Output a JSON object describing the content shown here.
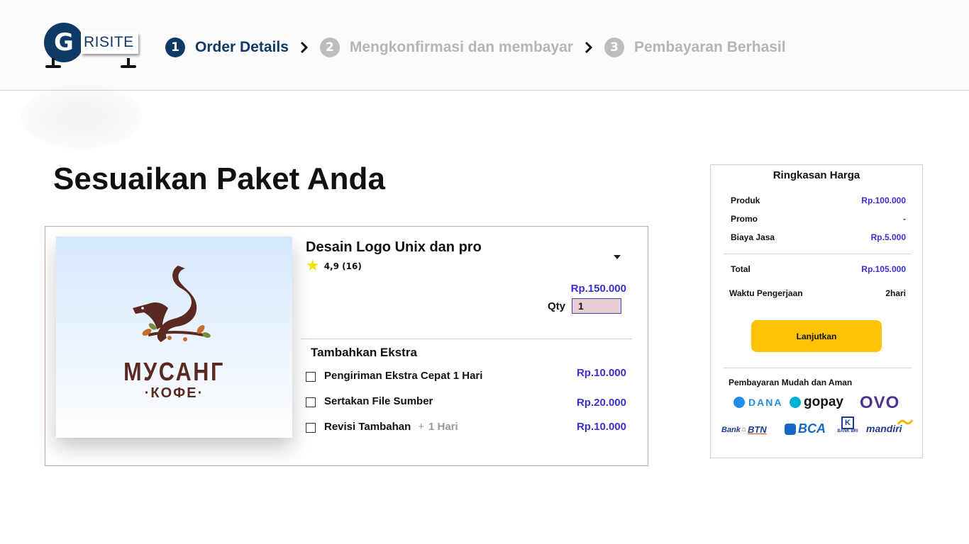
{
  "header": {
    "logo": {
      "letter": "G",
      "text": "RISITE"
    },
    "steps": [
      {
        "num": "1",
        "label": "Order Details"
      },
      {
        "num": "2",
        "label": "Mengkonfirmasi dan membayar"
      },
      {
        "num": "3",
        "label": "Pembayaran Berhasil"
      }
    ]
  },
  "page_title": "Sesuaikan Paket Anda",
  "product": {
    "brand": {
      "name": "МУСАНГ",
      "sub": "·КОФЕ·"
    },
    "name": "Desain Logo Unix dan pro",
    "rating": "4,9 (16)",
    "price": "Rp.150.000",
    "qty_label": "Qty",
    "qty_value": "1",
    "extras_title": "Tambahkan Ekstra",
    "extras": [
      {
        "label": "Pengiriman Ekstra Cepat 1 Hari",
        "price": "Rp.10.000"
      },
      {
        "label": "Sertakan File Sumber",
        "price": "Rp.20.000"
      },
      {
        "label": "Revisi Tambahan",
        "extra": "1 Hari",
        "price": "Rp.10.000"
      }
    ]
  },
  "summary": {
    "title": "Ringkasan Harga",
    "rows": [
      {
        "label": "Produk",
        "value": "Rp.100.000"
      },
      {
        "label": "Promo",
        "value": "-"
      },
      {
        "label": "Biaya Jasa",
        "value": "Rp.5.000"
      }
    ],
    "total": {
      "label": "Total",
      "value": "Rp.105.000"
    },
    "duration": {
      "label": "Waktu Pengerjaan",
      "value": "2hari"
    },
    "button": "Lanjutkan",
    "payment_title": "Pembayaran Mudah dan Aman",
    "payment_logos": {
      "dana": "DANA",
      "gopay": "gopay",
      "ovo": "OVO",
      "btn_prefix": "Bank",
      "btn": "BTN",
      "bca": "BCA",
      "bri": "BANK BRI",
      "mandiri": "mandiri"
    }
  },
  "colors": {
    "brand_navy": "#103a66",
    "price_blue": "#3b2fd1",
    "button_yellow": "#fcc203",
    "coffee_brown": "#5a2a22"
  }
}
